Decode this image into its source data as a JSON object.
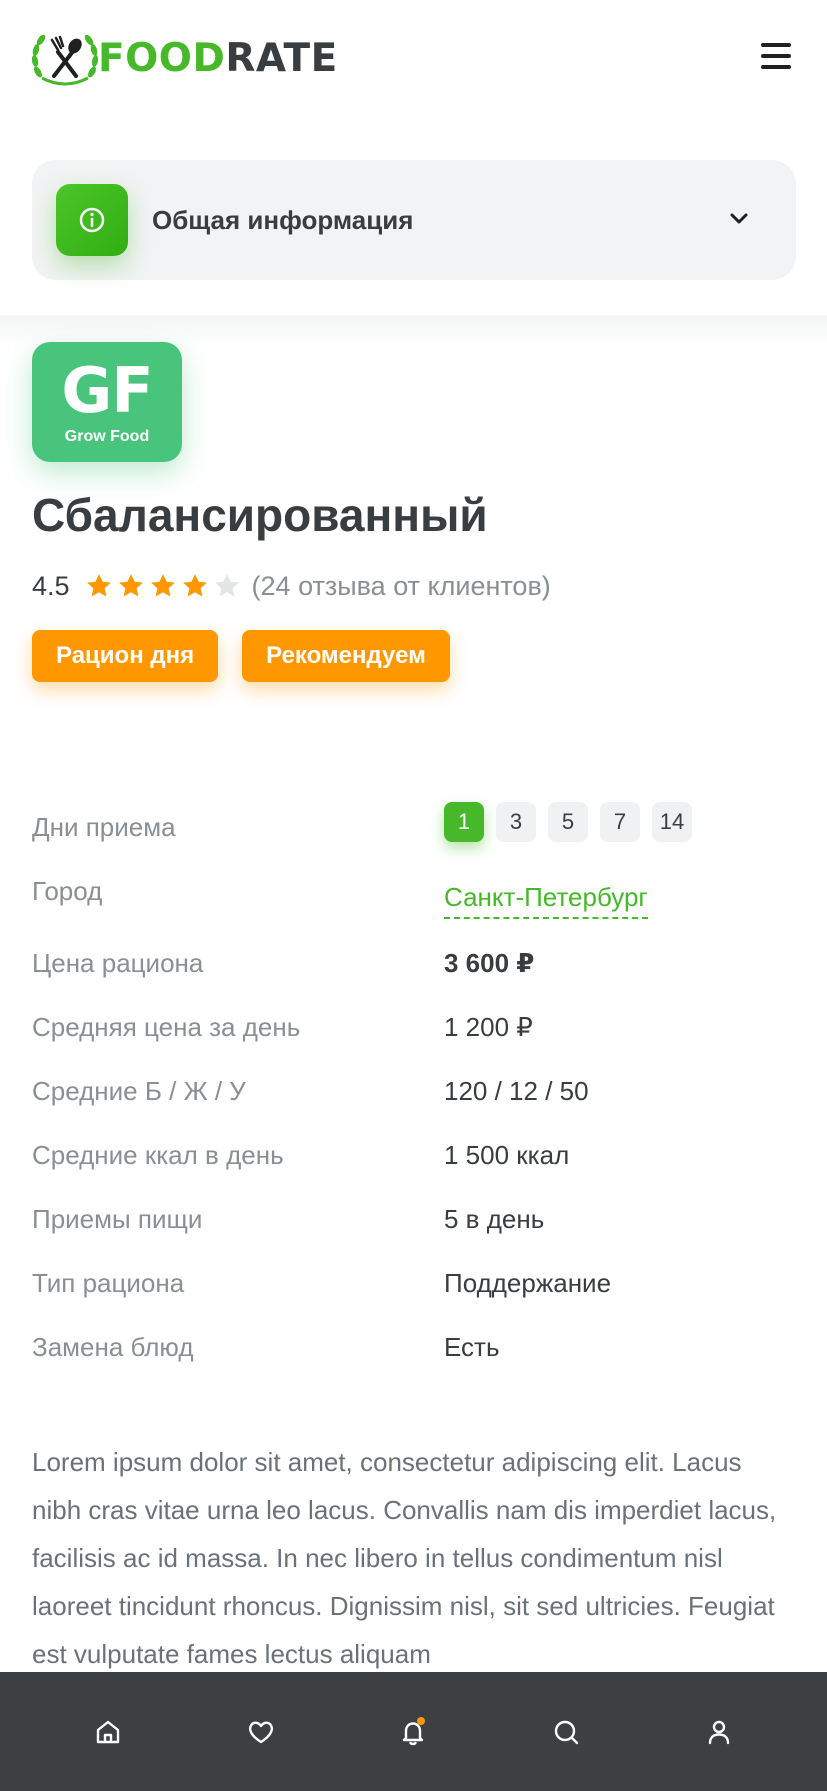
{
  "header": {
    "logo_food": "FOOD",
    "logo_rate": "RATE",
    "logo_emblem_icon": "fork-spoon-wreath-icon",
    "menu_icon": "hamburger-menu-icon"
  },
  "accordion": {
    "title": "Общая информация",
    "icon": "info-icon",
    "chevron_icon": "chevron-down-icon"
  },
  "brand": {
    "abbr": "GF",
    "name": "Grow Food",
    "color": "#48c47c"
  },
  "product": {
    "title": "Сбалансированный",
    "rating_value": "4.5",
    "stars_filled": 4,
    "stars_total": 5,
    "reviews": "(24 отзыва от клиентов)"
  },
  "badges": [
    "Рацион дня",
    "Рекомендуем"
  ],
  "info": {
    "days_label": "Дни приема",
    "days": [
      "1",
      "3",
      "5",
      "7",
      "14"
    ],
    "days_selected": "1",
    "city_label": "Город",
    "city_value": "Санкт-Петербург",
    "price_label": "Цена рациона",
    "price_value": "3 600 ₽",
    "avg_price_label": "Средняя цена за день",
    "avg_price_value": "1 200 ₽",
    "bju_label": "Средние Б / Ж / У",
    "bju_value": "120 / 12 / 50",
    "kcal_label": "Средние ккал в день",
    "kcal_value": "1 500 ккал",
    "meals_label": "Приемы пищи",
    "meals_value": "5 в день",
    "type_label": "Тип рациона",
    "type_value": "Поддержание",
    "replace_label": "Замена блюд",
    "replace_value": "Есть"
  },
  "description": "Lorem ipsum dolor sit amet, consectetur adipiscing elit. Lacus nibh cras vitae urna leo lacus. Convallis nam dis imperdiet lacus, facilisis ac id massa. In nec libero in tellus condimentum nisl laoreet tincidunt rhoncus. Dignissim nisl, sit sed ultricies. Feugiat est vulputate fames lectus aliquam",
  "bottom_nav": [
    "home-icon",
    "heart-icon",
    "bell-icon",
    "search-icon",
    "user-icon"
  ],
  "colors": {
    "brand_green": "#46b829",
    "accent_orange": "#ff9800",
    "nav_bg": "#3d4043"
  }
}
